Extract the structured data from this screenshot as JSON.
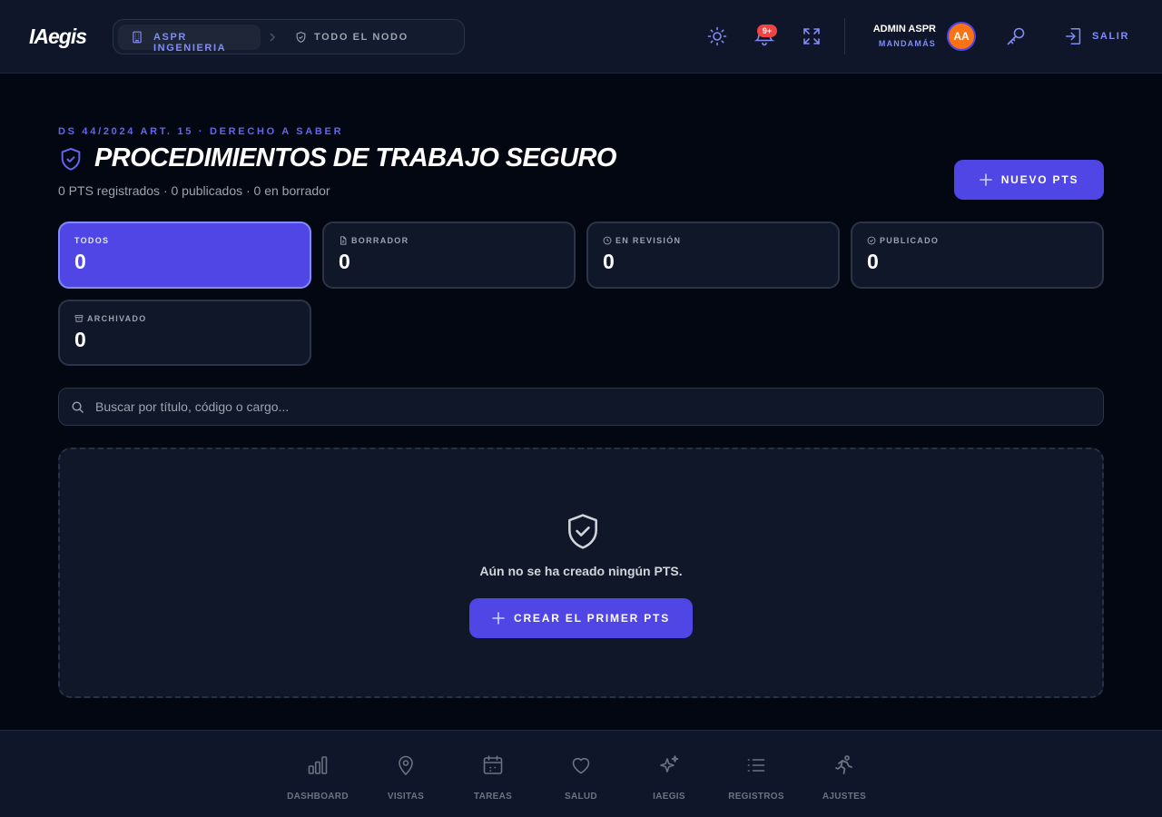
{
  "header": {
    "logo": "IAegis",
    "breadcrumb": {
      "organization": "ASPR INGENIERIA",
      "node": "TODO EL NODO"
    },
    "notifications_badge": "9+",
    "user": {
      "name": "ADMIN ASPR",
      "role": "MANDAMÁS",
      "initials": "AA"
    },
    "logout_label": "SALIR"
  },
  "page": {
    "eyebrow": "DS 44/2024 ART. 15 · DERECHO A SABER",
    "title": "PROCEDIMIENTOS DE TRABAJO SEGURO",
    "subtitle": "0 PTS registrados · 0 publicados · 0 en borrador",
    "new_button": "NUEVO PTS"
  },
  "stats": [
    {
      "label": "TODOS",
      "value": "0",
      "active": true,
      "icon": ""
    },
    {
      "label": "BORRADOR",
      "value": "0",
      "active": false,
      "icon": "document-icon"
    },
    {
      "label": "EN REVISIÓN",
      "value": "0",
      "active": false,
      "icon": "clock-icon"
    },
    {
      "label": "PUBLICADO",
      "value": "0",
      "active": false,
      "icon": "check-circle-icon"
    },
    {
      "label": "ARCHIVADO",
      "value": "0",
      "active": false,
      "icon": "archive-icon"
    }
  ],
  "search": {
    "placeholder": "Buscar por título, código o cargo..."
  },
  "empty_state": {
    "message": "Aún no se ha creado ningún PTS.",
    "button": "CREAR EL PRIMER PTS"
  },
  "bottom_nav": [
    {
      "label": "DASHBOARD",
      "icon": "bar-chart-icon"
    },
    {
      "label": "VISITAS",
      "icon": "map-pin-icon"
    },
    {
      "label": "TAREAS",
      "icon": "calendar-icon"
    },
    {
      "label": "SALUD",
      "icon": "heart-icon"
    },
    {
      "label": "IAEGIS",
      "icon": "sparkles-icon"
    },
    {
      "label": "REGISTROS",
      "icon": "list-icon"
    },
    {
      "label": "AJUSTES",
      "icon": "running-person-icon"
    }
  ],
  "colors": {
    "background": "#030712",
    "surface": "#0f1729",
    "accent": "#4f46e5",
    "accent_text": "#818cf8",
    "badge": "#ef4444",
    "avatar": "#f97316"
  }
}
